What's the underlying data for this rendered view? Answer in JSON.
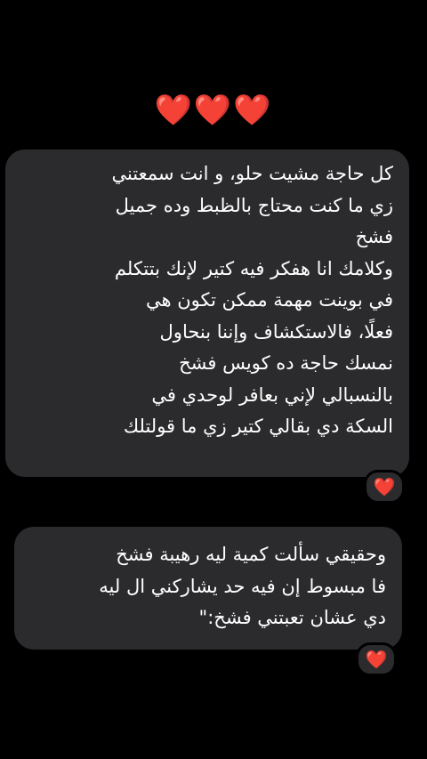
{
  "header": {
    "hearts": "❤️❤️❤️"
  },
  "messages": [
    {
      "lines": [
        "كل حاجة مشيت حلو، و انت سمعتني",
        "زي ما كنت محتاج بالظبط وده جميل",
        "فشخ",
        "وكلامك انا هفكر فيه كتير لإنك بتتكلم",
        "في بوينت مهمة ممكن تكون هي",
        "فعلًا، فالاستكشاف وإننا بنحاول",
        "نمسك حاجة ده كويس فشخ",
        "بالنسبالي لإني بعافر لوحدي في",
        "السكة دي بقالي كتير زي ما قولتلك"
      ],
      "reaction": "❤️"
    },
    {
      "lines": [
        "وحقيقي سألت كمية ليه رهيبة فشخ",
        "فا مبسوط إن فيه حد يشاركني ال ليه",
        "دي عشان تعبتني فشخ:\""
      ],
      "reaction": "❤️"
    }
  ],
  "colors": {
    "background": "#000000",
    "bubble": "#2b2b2d",
    "text": "#ffffff",
    "heart": "#e0202b"
  }
}
